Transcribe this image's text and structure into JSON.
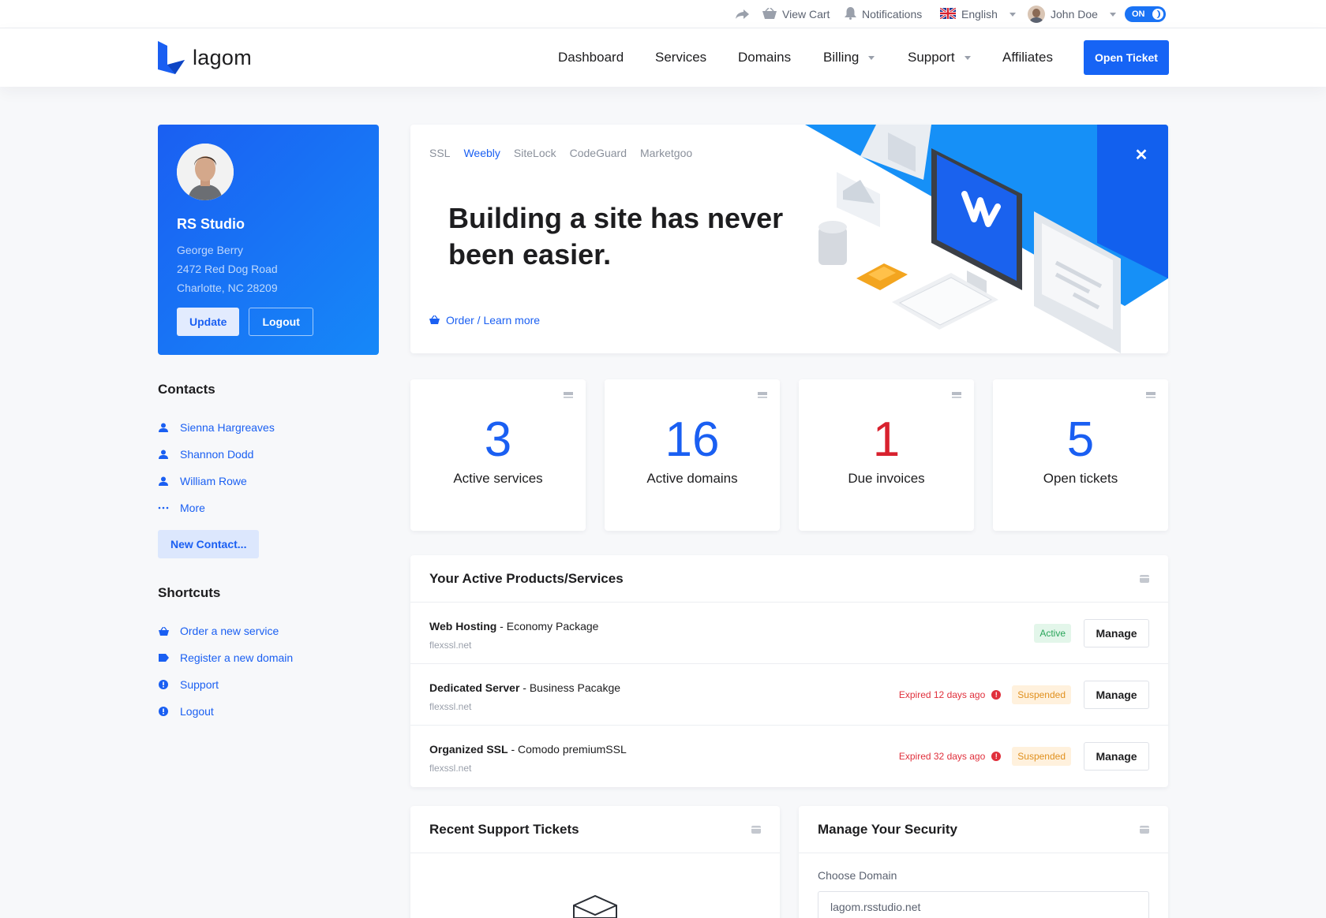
{
  "topbar": {
    "view_cart": "View Cart",
    "notifications": "Notifications",
    "language": "English",
    "user": "John Doe",
    "toggle": "ON"
  },
  "header": {
    "logo": "lagom",
    "nav": [
      "Dashboard",
      "Services",
      "Domains",
      "Billing",
      "Support",
      "Affiliates"
    ],
    "cta": "Open Ticket"
  },
  "profile": {
    "company": "RS Studio",
    "name": "George Berry",
    "street": "2472 Red Dog Road",
    "city": "Charlotte, NC 28209",
    "update": "Update",
    "logout": "Logout"
  },
  "contacts": {
    "title": "Contacts",
    "items": [
      "Sienna Hargreaves",
      "Shannon Dodd",
      "William Rowe"
    ],
    "more": "More",
    "new": "New Contact..."
  },
  "shortcuts": {
    "title": "Shortcuts",
    "items": [
      "Order a new service",
      "Register a new domain",
      "Support",
      "Logout"
    ]
  },
  "promo": {
    "tabs": [
      "SSL",
      "Weebly",
      "SiteLock",
      "CodeGuard",
      "Marketgoo"
    ],
    "active_tab": "Weebly",
    "headline": "Building a site has never been easier.",
    "link": "Order / Learn more"
  },
  "stats": [
    {
      "value": "3",
      "label": "Active services",
      "color": "#1a5ff2"
    },
    {
      "value": "16",
      "label": "Active domains",
      "color": "#1a5ff2"
    },
    {
      "value": "1",
      "label": "Due invoices",
      "color": "#d8212e"
    },
    {
      "value": "5",
      "label": "Open tickets",
      "color": "#1a5ff2"
    }
  ],
  "services": {
    "title": "Your Active Products/Services",
    "rows": [
      {
        "product": "Web Hosting",
        "package": " - Economy Package",
        "domain": "flexssl.net",
        "expired": "",
        "status": "Active",
        "action": "Manage"
      },
      {
        "product": "Dedicated Server",
        "package": " - Business Pacakge",
        "domain": "flexssl.net",
        "expired": "Expired 12 days ago",
        "status": "Suspended",
        "action": "Manage"
      },
      {
        "product": "Organized SSL",
        "package": " - Comodo premiumSSL",
        "domain": "flexssl.net",
        "expired": "Expired 32 days ago",
        "status": "Suspended",
        "action": "Manage"
      }
    ]
  },
  "tickets": {
    "title": "Recent Support Tickets"
  },
  "security": {
    "title": "Manage Your Security",
    "label": "Choose Domain",
    "value": "lagom.rsstudio.net"
  }
}
